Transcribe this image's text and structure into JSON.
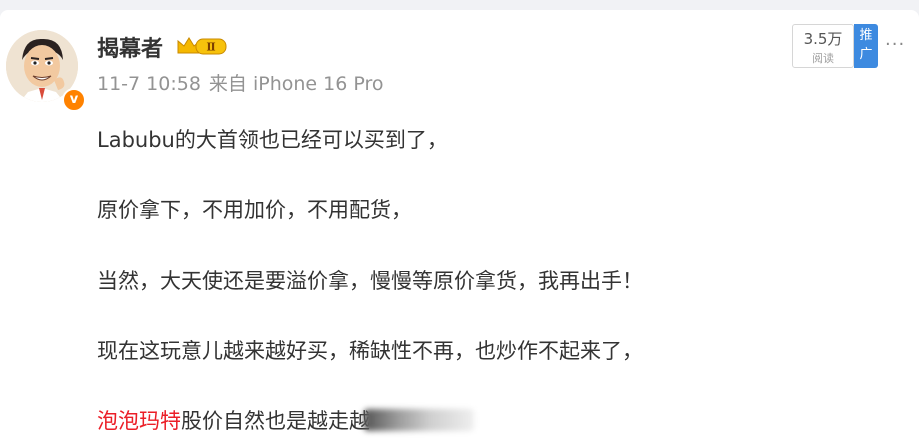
{
  "post": {
    "author": {
      "name": "揭幕者",
      "level_badge": "Ⅱ",
      "verified_mark": "v"
    },
    "meta": {
      "time": "11-7 10:58",
      "source": "来自 iPhone 16 Pro"
    },
    "stats": {
      "reads_value": "3.5万",
      "reads_label": "阅读",
      "promote_label": "推广"
    },
    "more_glyph": "···",
    "paragraphs": [
      "Labubu的大首领也已经可以买到了，",
      "原价拿下，不用加价，不用配货，",
      "当然，大天使还是要溢价拿，慢慢等原价拿货，我再出手！",
      "现在这玩意儿越来越好买，稀缺性不再，也炒作不起来了，"
    ],
    "last_paragraph": {
      "link_text": "泡泡玛特",
      "text": "股价自然也是越走越"
    }
  },
  "colors": {
    "link": "#eb1e27",
    "promo": "#3d8ae0",
    "verified": "#ff8200"
  },
  "icons": [
    "crown-badge-icon",
    "more-icon"
  ]
}
